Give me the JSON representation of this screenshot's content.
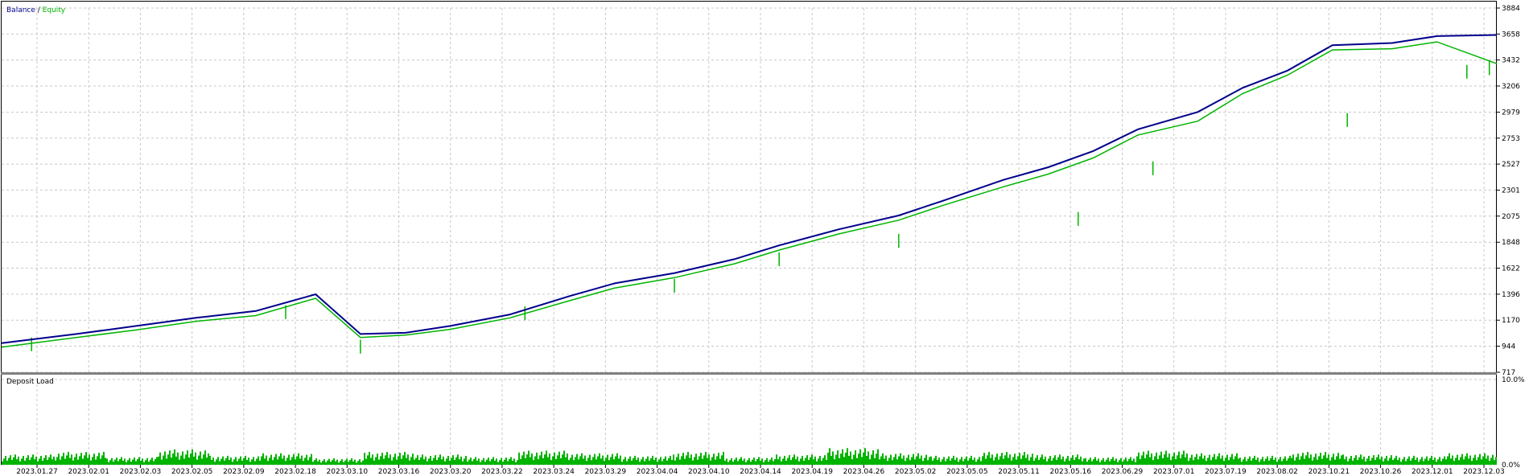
{
  "chart_data": [
    {
      "type": "line",
      "title": "",
      "legend": {
        "position": "top-left",
        "separator": " / "
      },
      "series": [
        {
          "name": "Balance",
          "color": "#00008b"
        },
        {
          "name": "Equity",
          "color": "#00b400"
        }
      ],
      "y_ticks": [
        "717",
        "944",
        "1170",
        "1396",
        "1622",
        "1848",
        "2075",
        "2301",
        "2527",
        "2753",
        "2979",
        "3206",
        "3432",
        "3658",
        "3884"
      ],
      "ylim": [
        717,
        3884
      ],
      "grid": true,
      "x": [
        0,
        0.05,
        0.09,
        0.13,
        0.17,
        0.21,
        0.24,
        0.27,
        0.3,
        0.34,
        0.38,
        0.41,
        0.45,
        0.49,
        0.52,
        0.56,
        0.6,
        0.63,
        0.67,
        0.7,
        0.73,
        0.76,
        0.8,
        0.83,
        0.86,
        0.89,
        0.93,
        0.96,
        1.0
      ],
      "balance": [
        970,
        1050,
        1120,
        1190,
        1250,
        1395,
        1050,
        1060,
        1120,
        1220,
        1380,
        1490,
        1580,
        1700,
        1820,
        1960,
        2080,
        2210,
        2390,
        2500,
        2640,
        2830,
        2980,
        3190,
        3340,
        3560,
        3580,
        3640,
        3650
      ],
      "equity": [
        935,
        1020,
        1085,
        1160,
        1210,
        1360,
        1020,
        1040,
        1090,
        1190,
        1340,
        1450,
        1540,
        1660,
        1780,
        1920,
        2040,
        2170,
        2330,
        2440,
        2580,
        2780,
        2900,
        3140,
        3300,
        3520,
        3530,
        3590,
        3400
      ],
      "equity_dips": [
        {
          "x": 0.02,
          "value": 900
        },
        {
          "x": 0.19,
          "value": 1180
        },
        {
          "x": 0.24,
          "value": 880
        },
        {
          "x": 0.35,
          "value": 1170
        },
        {
          "x": 0.45,
          "value": 1410
        },
        {
          "x": 0.52,
          "value": 1640
        },
        {
          "x": 0.6,
          "value": 1800
        },
        {
          "x": 0.72,
          "value": 1990
        },
        {
          "x": 0.77,
          "value": 2430
        },
        {
          "x": 0.9,
          "value": 2850
        },
        {
          "x": 0.98,
          "value": 3270
        },
        {
          "x": 0.995,
          "value": 3300
        }
      ]
    },
    {
      "type": "bar",
      "title": "Deposit Load",
      "y_ticks": [
        "0.0%",
        "10.0%"
      ],
      "ylim": [
        0,
        10
      ],
      "color": "#00b400",
      "levels": [
        0.8,
        1.0,
        0.6,
        1.2,
        0.7,
        0.9,
        0.5,
        1.0,
        0.8,
        0.6,
        1.1,
        0.9,
        0.7,
        1.0,
        0.6,
        0.8,
        1.3,
        0.9,
        0.7,
        1.0,
        0.8,
        0.6,
        1.1,
        0.9,
        0.7,
        1.0,
        0.8,
        0.7,
        0.9
      ],
      "x_ticks": [
        "2023.01.27",
        "2023.02.01",
        "2023.02.03",
        "2023.02.05",
        "2023.02.09",
        "2023.02.18",
        "2023.03.10",
        "2023.03.16",
        "2023.03.20",
        "2023.03.22",
        "2023.03.24",
        "2023.03.29",
        "2023.04.04",
        "2023.04.10",
        "2023.04.14",
        "2023.04.19",
        "2023.04.26",
        "2023.05.02",
        "2023.05.05",
        "2023.05.11",
        "2023.05.16",
        "2023.06.29",
        "2023.07.01",
        "2023.07.19",
        "2023.08.02",
        "2023.10.21",
        "2023.10.26",
        "2023.12.01",
        "2023.12.03"
      ]
    }
  ]
}
